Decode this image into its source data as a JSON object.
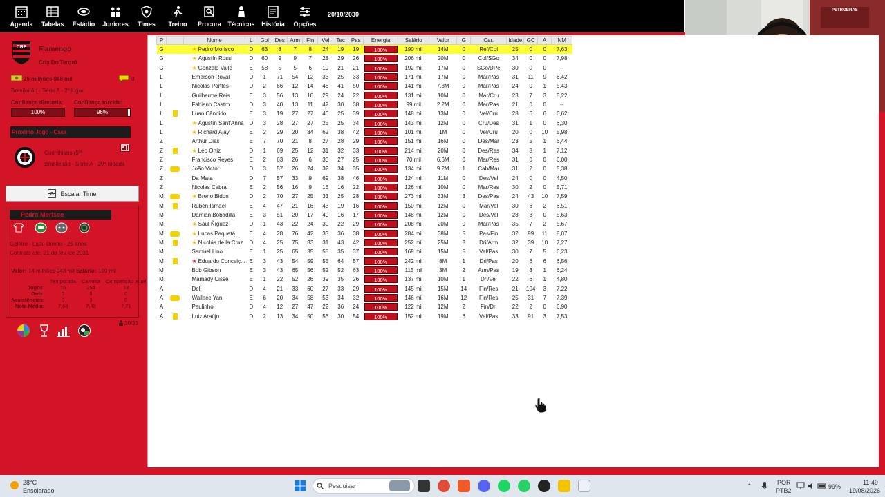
{
  "nav": {
    "items": [
      {
        "label": "Agenda",
        "icon": "calendar-icon"
      },
      {
        "label": "Tabelas",
        "icon": "table-icon"
      },
      {
        "label": "Estádio",
        "icon": "stadium-icon"
      },
      {
        "label": "Juniores",
        "icon": "juniors-icon"
      },
      {
        "label": "Times",
        "icon": "shield-icon"
      },
      {
        "label": "Treino",
        "icon": "training-icon"
      },
      {
        "label": "Procura",
        "icon": "search-player-icon"
      },
      {
        "label": "Técnicos",
        "icon": "coach-icon"
      },
      {
        "label": "História",
        "icon": "history-icon"
      },
      {
        "label": "Opções",
        "icon": "options-icon"
      }
    ],
    "date": "20/10/2030"
  },
  "club": {
    "name": "Flamengo",
    "subtitle": "Cria Do Terorô",
    "money": "26 milhões 848 mil",
    "messages": "0",
    "league": "Brasileirão - Série A - 2º lugar",
    "board_label": "Confiança diretoria:",
    "board_value": "100%",
    "fans_label": "Confiança torcida:",
    "fans_value": "96%",
    "fans_fraction": 0.96,
    "next_game_title": "Próximo Jogo - Casa",
    "opponent": "Corinthians (5º)",
    "competition": "Brasileirão - Série A - 29ª rodada",
    "escalar_label": "Escalar Time",
    "colors": {
      "primary": "#d31427",
      "dark": "#1c1c1c"
    }
  },
  "player_panel": {
    "name": "Pedro Morisco",
    "description": "Goleiro - Lado Direito - 25 anos",
    "contract": "Contrato até: 21 de fev. de 2031",
    "value_label": "Valor:",
    "value": "14 milhões 943 mil",
    "salary_label": "Salário:",
    "salary": "190 mil",
    "stats_headers": [
      "Temporada",
      "Carreira",
      "Competição atual"
    ],
    "stats_rows": [
      {
        "label": "Jogos:",
        "values": [
          "16",
          "254",
          "13"
        ]
      },
      {
        "label": "Gols:",
        "values": [
          "0",
          "0",
          "0"
        ]
      },
      {
        "label": "Assistências:",
        "values": [
          "0",
          "3",
          "0"
        ]
      },
      {
        "label": "Nota Média:",
        "values": [
          "7,63",
          "7,43",
          "7,71"
        ]
      }
    ],
    "squad_count": "30/35"
  },
  "table": {
    "headers": [
      "P",
      "",
      "Nome",
      "L",
      "Gol",
      "Des",
      "Arm",
      "Fin",
      "Vel",
      "Tec",
      "Pas",
      "Energia",
      "Salário",
      "Valor",
      "G",
      "Car.",
      "Idade",
      "GC",
      "A",
      "NM"
    ],
    "rows": [
      {
        "p": "G",
        "card": "",
        "star": "gold",
        "name": "Pedro Morisco",
        "l": "D",
        "gol": "63",
        "des": "8",
        "arm": "7",
        "fin": "8",
        "vel": "24",
        "tec": "19",
        "pas": "19",
        "energy": "100%",
        "salary": "190 mil",
        "value": "14M",
        "g": "0",
        "car": "Ref/Col",
        "age": "25",
        "gc": "0",
        "a": "0",
        "nm": "7,63",
        "selected": true,
        "age_red": false,
        "nm_green": true
      },
      {
        "p": "G",
        "card": "",
        "star": "gold",
        "name": "Agustín Rossi",
        "l": "D",
        "gol": "60",
        "des": "9",
        "arm": "9",
        "fin": "7",
        "vel": "28",
        "tec": "29",
        "pas": "26",
        "energy": "100%",
        "salary": "206 mil",
        "value": "20M",
        "g": "0",
        "car": "Col/SGo",
        "age": "34",
        "gc": "0",
        "a": "0",
        "nm": "7,98",
        "selected": false,
        "age_red": true,
        "nm_green": true
      },
      {
        "p": "G",
        "card": "",
        "star": "gold",
        "name": "Gonzalo Valle",
        "l": "E",
        "gol": "58",
        "des": "5",
        "arm": "5",
        "fin": "6",
        "vel": "19",
        "tec": "21",
        "pas": "21",
        "energy": "100%",
        "salary": "192 mil",
        "value": "17M",
        "g": "0",
        "car": "SGo/DPe",
        "age": "30",
        "gc": "0",
        "a": "0",
        "nm": "--",
        "selected": false,
        "age_red": false,
        "nm_green": false
      },
      {
        "p": "L",
        "card": "",
        "star": "",
        "name": "Emerson Royal",
        "l": "D",
        "gol": "1",
        "des": "71",
        "arm": "54",
        "fin": "12",
        "vel": "33",
        "tec": "25",
        "pas": "33",
        "energy": "100%",
        "salary": "171 mil",
        "value": "17M",
        "g": "0",
        "car": "Mar/Pas",
        "age": "31",
        "gc": "11",
        "a": "9",
        "nm": "6,42",
        "selected": false,
        "age_red": false,
        "nm_green": false
      },
      {
        "p": "L",
        "card": "",
        "star": "",
        "name": "Nicolas Pontes",
        "l": "D",
        "gol": "2",
        "des": "66",
        "arm": "12",
        "fin": "14",
        "vel": "48",
        "tec": "41",
        "pas": "50",
        "energy": "100%",
        "salary": "141 mil",
        "value": "7.8M",
        "g": "0",
        "car": "Mar/Pas",
        "age": "24",
        "gc": "0",
        "a": "1",
        "nm": "5,43",
        "selected": false,
        "age_red": false,
        "nm_green": false
      },
      {
        "p": "L",
        "card": "",
        "star": "",
        "name": "Guilherme Reis",
        "l": "E",
        "gol": "3",
        "des": "56",
        "arm": "13",
        "fin": "10",
        "vel": "29",
        "tec": "24",
        "pas": "22",
        "energy": "100%",
        "salary": "131 mil",
        "value": "10M",
        "g": "0",
        "car": "Mar/Cru",
        "age": "23",
        "gc": "7",
        "a": "3",
        "nm": "5,22",
        "selected": false,
        "age_red": false,
        "nm_green": false
      },
      {
        "p": "L",
        "card": "",
        "star": "",
        "name": "Fabiano Castro",
        "l": "D",
        "gol": "3",
        "des": "40",
        "arm": "13",
        "fin": "11",
        "vel": "42",
        "tec": "30",
        "pas": "38",
        "energy": "100%",
        "salary": "99 mil",
        "value": "2.2M",
        "g": "0",
        "car": "Mar/Pas",
        "age": "21",
        "gc": "0",
        "a": "0",
        "nm": "--",
        "selected": false,
        "age_red": false,
        "nm_green": false
      },
      {
        "p": "L",
        "card": "yellow",
        "star": "",
        "name": "Luan Cândido",
        "l": "E",
        "gol": "3",
        "des": "19",
        "arm": "27",
        "fin": "27",
        "vel": "40",
        "tec": "25",
        "pas": "39",
        "energy": "100%",
        "salary": "148 mil",
        "value": "13M",
        "g": "0",
        "car": "Vel/Cru",
        "age": "28",
        "gc": "6",
        "a": "6",
        "nm": "6,62",
        "selected": false,
        "age_red": true,
        "nm_green": false
      },
      {
        "p": "L",
        "card": "",
        "star": "gold",
        "name": "Agustín Sant'Anna",
        "l": "D",
        "gol": "3",
        "des": "28",
        "arm": "27",
        "fin": "27",
        "vel": "25",
        "tec": "25",
        "pas": "34",
        "energy": "100%",
        "salary": "143 mil",
        "value": "12M",
        "g": "0",
        "car": "Cru/Des",
        "age": "31",
        "gc": "1",
        "a": "0",
        "nm": "6,30",
        "selected": false,
        "age_red": false,
        "nm_green": false
      },
      {
        "p": "L",
        "card": "",
        "star": "gold",
        "name": "Richard Ajayi",
        "l": "E",
        "gol": "2",
        "des": "29",
        "arm": "20",
        "fin": "34",
        "vel": "62",
        "tec": "38",
        "pas": "42",
        "energy": "100%",
        "salary": "101 mil",
        "value": "1M",
        "g": "0",
        "car": "Vel/Cru",
        "age": "20",
        "gc": "0",
        "a": "10",
        "nm": "5,98",
        "selected": false,
        "age_red": true,
        "nm_green": false
      },
      {
        "p": "Z",
        "card": "",
        "star": "",
        "name": "Arthur Dias",
        "l": "E",
        "gol": "7",
        "des": "70",
        "arm": "21",
        "fin": "8",
        "vel": "27",
        "tec": "28",
        "pas": "29",
        "energy": "100%",
        "salary": "151 mil",
        "value": "16M",
        "g": "0",
        "car": "Des/Mar",
        "age": "23",
        "gc": "5",
        "a": "1",
        "nm": "6,44",
        "selected": false,
        "age_red": false,
        "nm_green": false
      },
      {
        "p": "Z",
        "card": "yellow",
        "star": "gold",
        "name": "Léo Ortiz",
        "l": "D",
        "gol": "1",
        "des": "69",
        "arm": "25",
        "fin": "12",
        "vel": "31",
        "tec": "32",
        "pas": "33",
        "energy": "100%",
        "salary": "214 mil",
        "value": "20M",
        "g": "0",
        "car": "Des/Res",
        "age": "34",
        "gc": "8",
        "a": "1",
        "nm": "7,12",
        "selected": false,
        "age_red": true,
        "nm_green": true
      },
      {
        "p": "Z",
        "card": "",
        "star": "",
        "name": "Francisco Reyes",
        "l": "E",
        "gol": "2",
        "des": "63",
        "arm": "26",
        "fin": "6",
        "vel": "30",
        "tec": "27",
        "pas": "25",
        "energy": "100%",
        "salary": "70 mil",
        "value": "6.6M",
        "g": "0",
        "car": "Mar/Res",
        "age": "31",
        "gc": "0",
        "a": "0",
        "nm": "6,00",
        "selected": false,
        "age_red": false,
        "nm_green": false
      },
      {
        "p": "Z",
        "card": "yellow2",
        "star": "",
        "name": "João Victor",
        "l": "D",
        "gol": "3",
        "des": "57",
        "arm": "26",
        "fin": "24",
        "vel": "32",
        "tec": "34",
        "pas": "35",
        "energy": "100%",
        "salary": "134 mil",
        "value": "9.2M",
        "g": "1",
        "car": "Cab/Mar",
        "age": "31",
        "gc": "2",
        "a": "0",
        "nm": "5,38",
        "selected": false,
        "age_red": false,
        "nm_green": false
      },
      {
        "p": "Z",
        "card": "",
        "star": "",
        "name": "Da Mata",
        "l": "D",
        "gol": "7",
        "des": "57",
        "arm": "33",
        "fin": "9",
        "vel": "69",
        "tec": "38",
        "pas": "46",
        "energy": "100%",
        "salary": "124 mil",
        "value": "11M",
        "g": "0",
        "car": "Des/Vel",
        "age": "24",
        "gc": "0",
        "a": "0",
        "nm": "4,50",
        "selected": false,
        "age_red": true,
        "nm_green": false
      },
      {
        "p": "Z",
        "card": "",
        "star": "",
        "name": "Nicolas Cabral",
        "l": "E",
        "gol": "2",
        "des": "56",
        "arm": "16",
        "fin": "9",
        "vel": "16",
        "tec": "16",
        "pas": "22",
        "energy": "100%",
        "salary": "126 mil",
        "value": "10M",
        "g": "0",
        "car": "Mar/Res",
        "age": "30",
        "gc": "2",
        "a": "0",
        "nm": "5,71",
        "selected": false,
        "age_red": false,
        "nm_green": false
      },
      {
        "p": "M",
        "card": "yellow2",
        "star": "gold",
        "name": "Breno Bidon",
        "l": "D",
        "gol": "2",
        "des": "70",
        "arm": "27",
        "fin": "25",
        "vel": "33",
        "tec": "25",
        "pas": "28",
        "energy": "100%",
        "salary": "273 mil",
        "value": "33M",
        "g": "3",
        "car": "Des/Pas",
        "age": "24",
        "gc": "43",
        "a": "10",
        "nm": "7,59",
        "selected": false,
        "age_red": true,
        "nm_green": true
      },
      {
        "p": "M",
        "card": "yellow",
        "star": "",
        "name": "Rúben Ismael",
        "l": "E",
        "gol": "4",
        "des": "47",
        "arm": "21",
        "fin": "16",
        "vel": "43",
        "tec": "19",
        "pas": "16",
        "energy": "100%",
        "salary": "150 mil",
        "value": "12M",
        "g": "0",
        "car": "Mar/Vel",
        "age": "30",
        "gc": "6",
        "a": "2",
        "nm": "6,51",
        "selected": false,
        "age_red": true,
        "nm_green": false
      },
      {
        "p": "M",
        "card": "",
        "star": "",
        "name": "Damián Bobadilla",
        "l": "E",
        "gol": "3",
        "des": "51",
        "arm": "20",
        "fin": "17",
        "vel": "40",
        "tec": "16",
        "pas": "17",
        "energy": "100%",
        "salary": "148 mil",
        "value": "12M",
        "g": "0",
        "car": "Des/Vel",
        "age": "28",
        "gc": "3",
        "a": "0",
        "nm": "5,63",
        "selected": false,
        "age_red": false,
        "nm_green": false
      },
      {
        "p": "M",
        "card": "",
        "star": "gold",
        "name": "Saúl Ñíguez",
        "l": "D",
        "gol": "1",
        "des": "43",
        "arm": "22",
        "fin": "24",
        "vel": "30",
        "tec": "22",
        "pas": "29",
        "energy": "100%",
        "salary": "208 mil",
        "value": "20M",
        "g": "0",
        "car": "Mar/Pas",
        "age": "35",
        "gc": "7",
        "a": "2",
        "nm": "5,67",
        "selected": false,
        "age_red": true,
        "nm_green": false
      },
      {
        "p": "M",
        "card": "yellow2",
        "star": "gold",
        "name": "Lucas Paquetá",
        "l": "E",
        "gol": "4",
        "des": "28",
        "arm": "76",
        "fin": "42",
        "vel": "33",
        "tec": "36",
        "pas": "38",
        "energy": "100%",
        "salary": "284 mil",
        "value": "38M",
        "g": "5",
        "car": "Pas/Fin",
        "age": "32",
        "gc": "99",
        "a": "11",
        "nm": "8,07",
        "selected": false,
        "age_red": false,
        "nm_green": true
      },
      {
        "p": "M",
        "card": "yellow",
        "star": "gold",
        "name": "Nicolás de la Cruz",
        "l": "D",
        "gol": "4",
        "des": "25",
        "arm": "75",
        "fin": "33",
        "vel": "31",
        "tec": "43",
        "pas": "42",
        "energy": "100%",
        "salary": "252 mil",
        "value": "25M",
        "g": "3",
        "car": "Dri/Arm",
        "age": "32",
        "gc": "39",
        "a": "10",
        "nm": "7,27",
        "selected": false,
        "age_red": false,
        "nm_green": true
      },
      {
        "p": "M",
        "card": "",
        "star": "",
        "name": "Samuel Lino",
        "l": "E",
        "gol": "1",
        "des": "25",
        "arm": "65",
        "fin": "35",
        "vel": "55",
        "tec": "35",
        "pas": "37",
        "energy": "100%",
        "salary": "169 mil",
        "value": "15M",
        "g": "5",
        "car": "Vel/Pas",
        "age": "30",
        "gc": "7",
        "a": "5",
        "nm": "6,23",
        "selected": false,
        "age_red": false,
        "nm_green": false
      },
      {
        "p": "M",
        "card": "yellow",
        "star": "red",
        "name": "Eduardo Conceiç...",
        "l": "E",
        "gol": "3",
        "des": "43",
        "arm": "54",
        "fin": "59",
        "vel": "55",
        "tec": "64",
        "pas": "57",
        "energy": "100%",
        "salary": "242 mil",
        "value": "8M",
        "g": "1",
        "car": "Dri/Pas",
        "age": "20",
        "gc": "6",
        "a": "6",
        "nm": "6,56",
        "selected": false,
        "age_red": true,
        "nm_green": false
      },
      {
        "p": "M",
        "card": "",
        "star": "",
        "name": "Bob Gibson",
        "l": "E",
        "gol": "3",
        "des": "43",
        "arm": "65",
        "fin": "56",
        "vel": "52",
        "tec": "52",
        "pas": "63",
        "energy": "100%",
        "salary": "115 mil",
        "value": "3M",
        "g": "2",
        "car": "Arm/Pas",
        "age": "19",
        "gc": "3",
        "a": "1",
        "nm": "6,24",
        "selected": false,
        "age_red": true,
        "nm_green": false
      },
      {
        "p": "M",
        "card": "",
        "star": "",
        "name": "Mamady Cissé",
        "l": "E",
        "gol": "1",
        "des": "22",
        "arm": "52",
        "fin": "26",
        "vel": "39",
        "tec": "35",
        "pas": "26",
        "energy": "100%",
        "salary": "137 mil",
        "value": "10M",
        "g": "1",
        "car": "Dri/Vel",
        "age": "22",
        "gc": "6",
        "a": "1",
        "nm": "4,80",
        "selected": false,
        "age_red": true,
        "nm_green": false
      },
      {
        "p": "A",
        "card": "",
        "star": "",
        "name": "Dell",
        "l": "D",
        "gol": "4",
        "des": "21",
        "arm": "33",
        "fin": "60",
        "vel": "27",
        "tec": "33",
        "pas": "29",
        "energy": "100%",
        "salary": "145 mil",
        "value": "15M",
        "g": "14",
        "car": "Fin/Res",
        "age": "21",
        "gc": "104",
        "a": "3",
        "nm": "7,22",
        "selected": false,
        "age_red": false,
        "nm_green": true
      },
      {
        "p": "A",
        "card": "yellow2",
        "star": "",
        "name": "Wallace Yan",
        "l": "E",
        "gol": "6",
        "des": "20",
        "arm": "34",
        "fin": "58",
        "vel": "53",
        "tec": "34",
        "pas": "32",
        "energy": "100%",
        "salary": "146 mil",
        "value": "16M",
        "g": "12",
        "car": "Fin/Res",
        "age": "25",
        "gc": "31",
        "a": "7",
        "nm": "7,39",
        "selected": false,
        "age_red": true,
        "nm_green": true
      },
      {
        "p": "A",
        "card": "",
        "star": "",
        "name": "Paulinho",
        "l": "D",
        "gol": "4",
        "des": "12",
        "arm": "27",
        "fin": "47",
        "vel": "22",
        "tec": "36",
        "pas": "24",
        "energy": "100%",
        "salary": "122 mil",
        "value": "12M",
        "g": "2",
        "car": "Fin/Dri",
        "age": "22",
        "gc": "2",
        "a": "0",
        "nm": "6,90",
        "selected": false,
        "age_red": false,
        "nm_green": false
      },
      {
        "p": "A",
        "card": "yellow",
        "star": "",
        "name": "Luiz Araújo",
        "l": "D",
        "gol": "2",
        "des": "13",
        "arm": "34",
        "fin": "50",
        "vel": "56",
        "tec": "30",
        "pas": "54",
        "energy": "100%",
        "salary": "152 mil",
        "value": "19M",
        "g": "6",
        "car": "Vel/Pas",
        "age": "33",
        "gc": "91",
        "a": "3",
        "nm": "7,53",
        "selected": false,
        "age_red": true,
        "nm_green": true
      }
    ]
  },
  "taskbar": {
    "weather_temp": "28°C",
    "weather_desc": "Ensolarado",
    "search_placeholder": "Pesquisar",
    "lang_line1": "POR",
    "lang_line2": "PTB2",
    "battery": "99%",
    "time": "11:49",
    "date": "19/08/2026",
    "webcam_shirt_text": "PETROBRAS"
  }
}
